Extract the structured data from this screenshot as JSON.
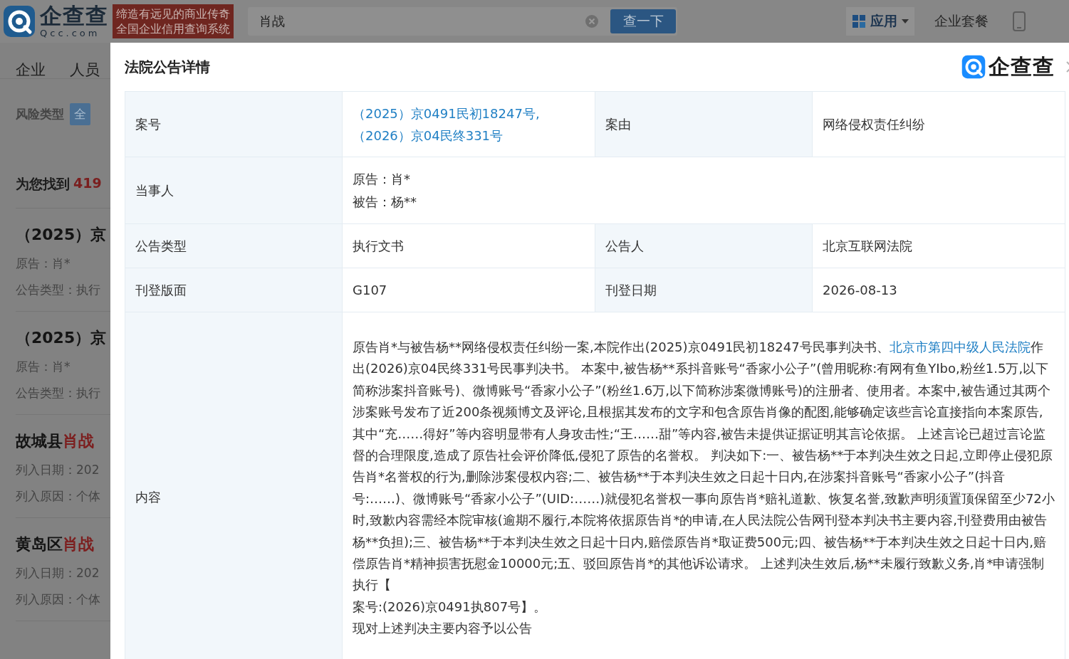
{
  "header": {
    "logo_text": "企查查",
    "logo_domain": "Qcc.com",
    "slogan": [
      "缔造有远见的商业传奇",
      "全国企业信用查询系统"
    ],
    "search": {
      "value": "肖战"
    },
    "search_button": "查一下",
    "apps_menu": "应用",
    "plans_link": "企业套餐"
  },
  "side": {
    "nav": [
      {
        "label": "企业"
      },
      {
        "label": "人员"
      }
    ],
    "filter_label": "风险类型",
    "filter_chip": "全",
    "found_prefix": "为您找到",
    "found_count": "419",
    "results": [
      {
        "title": [
          {
            "text": "（2025）京",
            "highlight": false
          }
        ],
        "lines": [
          "原告：肖*",
          "公告类型：执行"
        ]
      },
      {
        "title": [
          {
            "text": "（2025）京",
            "highlight": false
          }
        ],
        "lines": [
          "原告：肖*",
          "公告类型：执行"
        ]
      },
      {
        "title": [
          {
            "text": "故城县",
            "highlight": false
          },
          {
            "text": "肖战",
            "highlight": true
          }
        ],
        "lines": [
          "列入日期：202",
          "列入原因：个体"
        ]
      },
      {
        "title": [
          {
            "text": "黄岛区",
            "highlight": false
          },
          {
            "text": "肖战",
            "highlight": true
          }
        ],
        "lines": [
          "列入日期：202",
          "列入原因：个体"
        ]
      }
    ]
  },
  "modal": {
    "title": "法院公告详情",
    "logo_text": "企查查",
    "rows": [
      {
        "cells": [
          {
            "label": "案号",
            "kind": "link",
            "value": "（2025）京0491民初18247号,（2026）京04民终331号"
          },
          {
            "label": "案由",
            "kind": "text",
            "value": "网络侵权责任纠纷"
          }
        ]
      },
      {
        "cells": [
          {
            "label": "当事人",
            "kind": "lines",
            "lines": [
              "原告：肖*",
              "被告：杨**"
            ]
          }
        ]
      },
      {
        "cells": [
          {
            "label": "公告类型",
            "kind": "text",
            "value": "执行文书"
          },
          {
            "label": "公告人",
            "kind": "text",
            "value": "北京互联网法院"
          }
        ]
      },
      {
        "cells": [
          {
            "label": "刊登版面",
            "kind": "text",
            "value": "G107"
          },
          {
            "label": "刊登日期",
            "kind": "text",
            "value": "2026-08-13"
          }
        ]
      },
      {
        "cells": [
          {
            "label": "内容",
            "kind": "paragraphs",
            "paragraphs": [
              [
                {
                  "text": "原告肖*与被告杨**网络侵权责任纠纷一案,本院作出(2025)京0491民初18247号民事判决书、",
                  "link": false
                },
                {
                  "text": "北京市第四中级人民法院",
                  "link": true
                },
                {
                  "text": "作出(2026)京04民终331号民事判决书。 本案中,被告杨**系抖音账号“香家小公子”(曾用昵称:有网有鱼YIbo,粉丝1.5万,以下简称涉案抖音账号)、微博账号“香家小公子”(粉丝1.6万,以下简称涉案微博账号)的注册者、使用者。本案中,被告通过其两个涉案账号发布了近200条视频博文及评论,且根据其发布的文字和包含原告肖像的配图,能够确定该些言论直接指向本案原告,其中“充……得好”等内容明显带有人身攻击性;“王……甜”等内容,被告未提供证据证明其言论依据。 上述言论已超过言论监督的合理限度,造成了原告社会评价降低,侵犯了原告的名誉权。 判决如下:一、被告杨**于本判决生效之日起,立即停止侵犯原告肖*名誉权的行为,删除涉案侵权内容;二、被告杨**于本判决生效之日起十日内,在涉案抖音账号“香家小公子”(抖音号:……)、微博账号“香家小公子”(UID:……)就侵犯名誉权一事向原告肖*赔礼道歉、恢复名誉,致歉声明须置顶保留至少72小时,致歉内容需经本院审核(逾期不履行,本院将依据原告肖*的申请,在人民法院公告网刊登本判决书主要内容,刊登费用由被告杨**负担);三、被告杨**于本判决生效之日起十日内,赔偿原告肖*取证费500元;四、被告杨**于本判决生效之日起十日内,赔偿原告肖*精神损害抚慰金10000元;五、驳回原告肖*的其他诉讼请求。 上述判决生效后,杨**未履行致歉义务,肖*申请强制执行【",
                  "link": false
                }
              ],
              [
                {
                  "text": "案号:(2026)京0491执807号】。",
                  "link": false
                }
              ],
              [
                {
                  "text": "现对上述判决主要内容予以公告",
                  "link": false
                }
              ]
            ]
          }
        ]
      }
    ]
  }
}
